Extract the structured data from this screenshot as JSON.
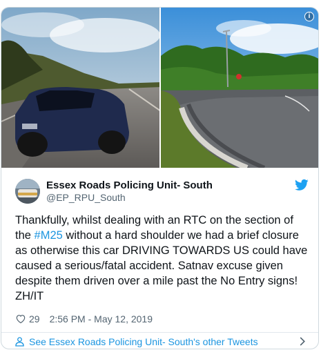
{
  "tweet": {
    "author_name": "Essex Roads Policing Unit- South",
    "author_handle": "@EP_RPU_South",
    "text_before": "Thankfully, whilst dealing with an RTC on the section of the ",
    "hashtag": "#M25",
    "text_after": " without a hard shoulder we had a brief closure as otherwise this car DRIVING TOWARDS US could have caused a serious/fatal accident. Satnav excuse given despite them driven over a mile past the No Entry signs! ZH/IT",
    "likes": "29",
    "timestamp": "2:56 PM - May 12, 2019"
  },
  "footer": {
    "other_tweets_label": "See Essex Roads Policing Unit- South's other Tweets"
  },
  "icons": {
    "info": "info-icon",
    "twitter": "twitter-bird-icon",
    "like": "heart-icon",
    "profile": "person-icon",
    "more": "chevron-right-icon"
  },
  "colors": {
    "accent": "#1b95e0",
    "text": "#0f1419",
    "muted": "#536471"
  }
}
